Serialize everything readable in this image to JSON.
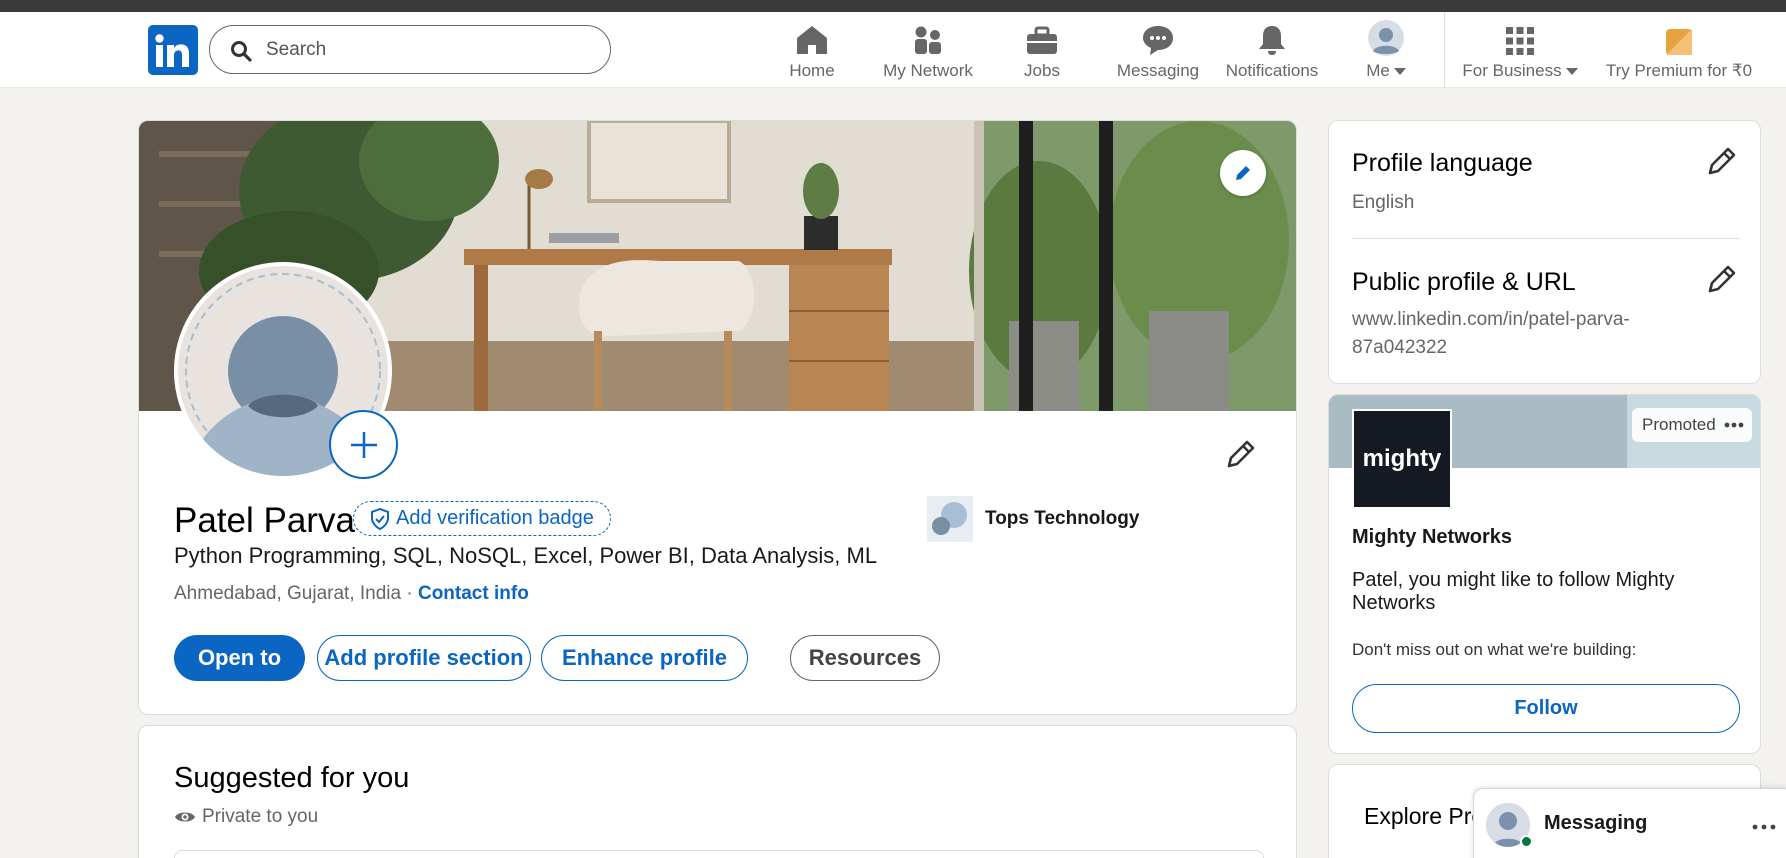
{
  "nav": {
    "search_placeholder": "Search",
    "items": [
      {
        "label": "Home",
        "icon": "home-icon"
      },
      {
        "label": "My Network",
        "icon": "network-icon"
      },
      {
        "label": "Jobs",
        "icon": "briefcase-icon"
      },
      {
        "label": "Messaging",
        "icon": "chat-icon"
      },
      {
        "label": "Notifications",
        "icon": "bell-icon"
      },
      {
        "label": "Me",
        "icon": "avatar"
      },
      {
        "label": "For Business",
        "icon": "grid-icon"
      },
      {
        "label": "Try Premium for ₹0",
        "icon": "premium-icon"
      }
    ]
  },
  "profile": {
    "name": "Patel Parva",
    "verification_badge": "Add verification badge",
    "headline": "Python Programming, SQL, NoSQL, Excel, Power BI, Data Analysis, ML",
    "location": "Ahmedabad, Gujarat, India",
    "separator": " · ",
    "contact_info": "Contact info",
    "company": "Tops Technology",
    "buttons": {
      "open_to": "Open to",
      "add_section": "Add profile section",
      "enhance": "Enhance profile",
      "resources": "Resources"
    }
  },
  "suggested": {
    "title": "Suggested for you",
    "privacy": "Private to you"
  },
  "sidebar": {
    "profile_language": {
      "title": "Profile language",
      "value": "English"
    },
    "public_profile": {
      "title": "Public profile & URL",
      "url_line1": "www.linkedin.com/in/patel-parva-",
      "url_line2": "87a042322"
    },
    "promo": {
      "logo_text": "mighty",
      "tag": "Promoted",
      "company": "Mighty Networks",
      "message": "Patel, you might like to follow Mighty Networks",
      "desc": "Don't miss out on what we're building:",
      "follow": "Follow"
    },
    "explore": {
      "title": "Explore Pre"
    }
  },
  "messaging": {
    "label": "Messaging"
  },
  "colors": {
    "brand": "#0a66c2",
    "background": "#f4f2ee",
    "online": "#057642"
  }
}
